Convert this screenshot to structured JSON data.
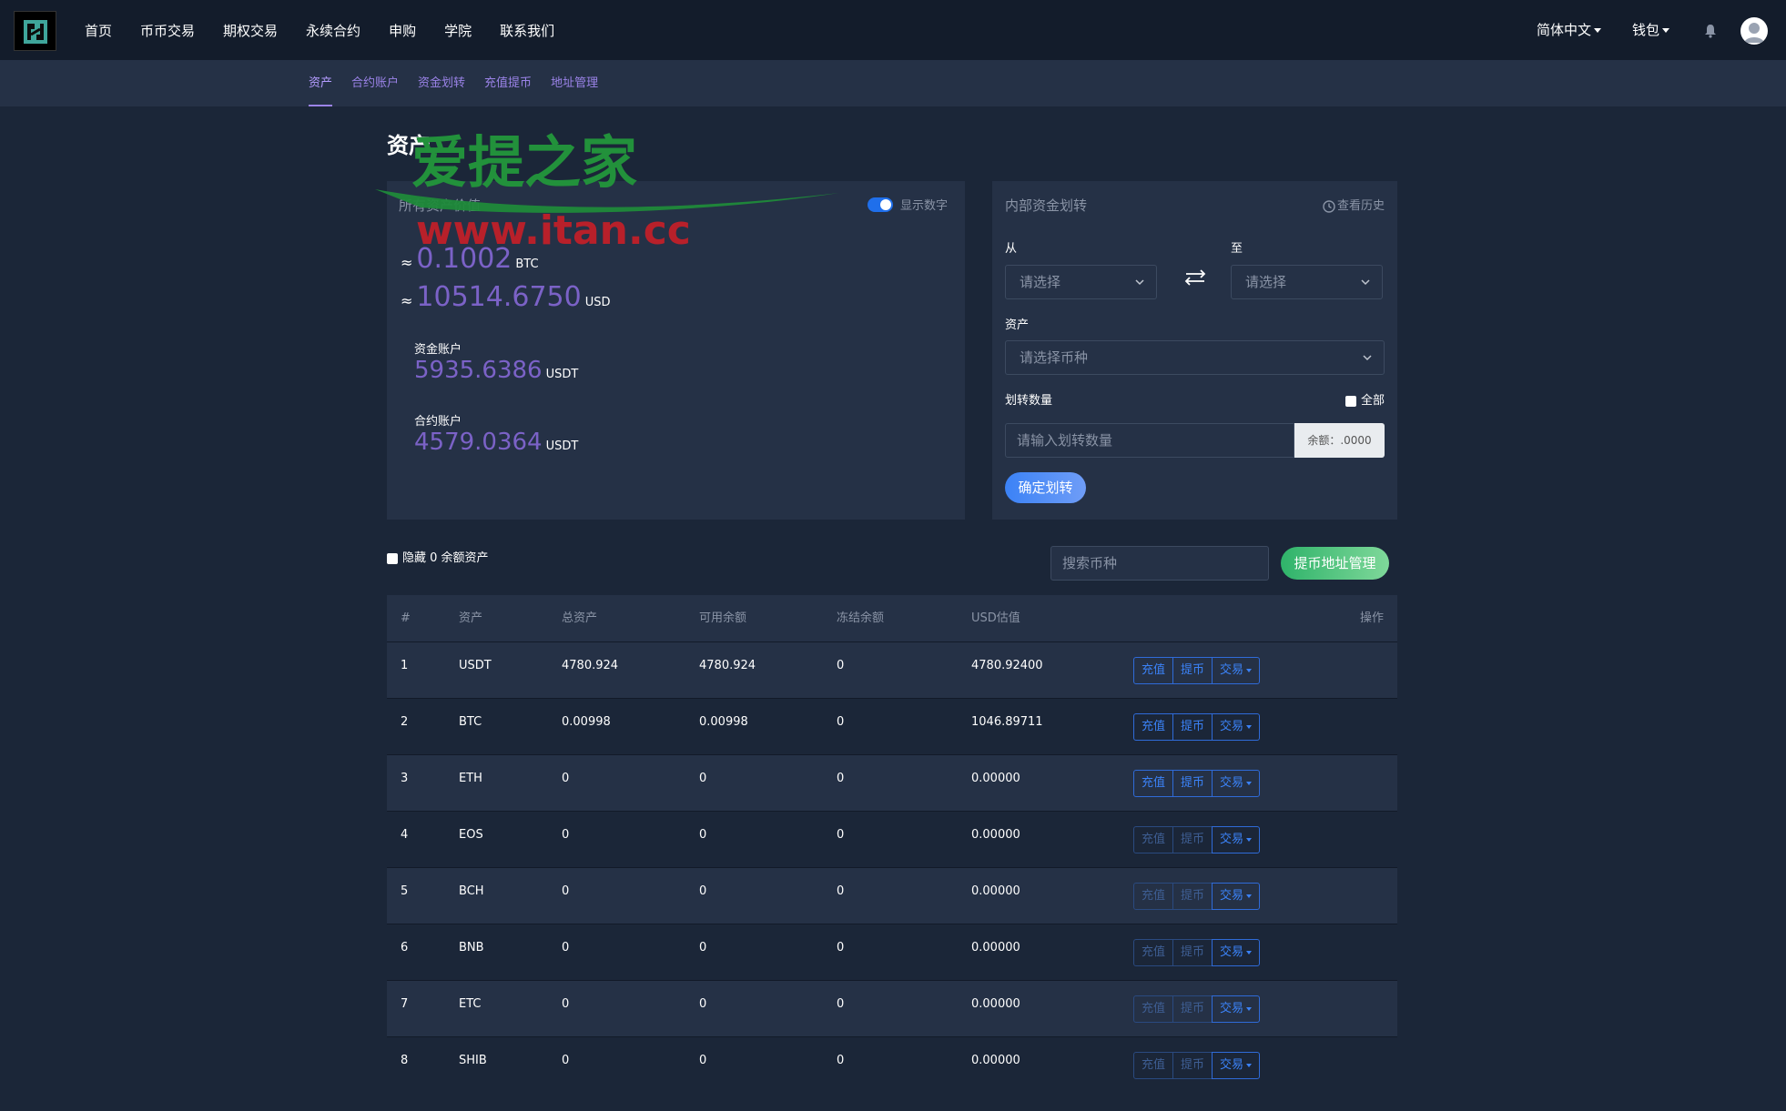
{
  "nav": {
    "items": [
      "首页",
      "币币交易",
      "期权交易",
      "永续合约",
      "申购",
      "学院",
      "联系我们"
    ],
    "language": "简体中文",
    "wallet": "钱包"
  },
  "subnav": {
    "items": [
      "资产",
      "合约账户",
      "资金划转",
      "充值提币",
      "地址管理"
    ]
  },
  "page": {
    "title": "资产"
  },
  "watermark": {
    "text": "爱提之家",
    "url": "www.itan.cc"
  },
  "assets_card": {
    "label": "所有资产价值",
    "toggle_label": "显示数字",
    "toggle_on": true,
    "approx": "≈",
    "btc_value": "0.1002",
    "btc_unit": "BTC",
    "usd_value": "10514.6750",
    "usd_unit": "USD",
    "fund_account_label": "资金账户",
    "fund_account_value": "5935.6386",
    "fund_account_unit": "USDT",
    "contract_account_label": "合约账户",
    "contract_account_value": "4579.0364",
    "contract_account_unit": "USDT"
  },
  "transfer": {
    "title": "内部资金划转",
    "history": "查看历史",
    "from_label": "从",
    "to_label": "至",
    "from_placeholder": "请选择",
    "to_placeholder": "请选择",
    "asset_label": "资产",
    "asset_placeholder": "请选择币种",
    "amount_label": "划转数量",
    "all_label": "全部",
    "amount_placeholder": "请输入划转数量",
    "balance": "余额：.0000",
    "confirm": "确定划转"
  },
  "list_controls": {
    "hide_zero": "隐藏 0 余额资产",
    "search_placeholder": "搜索币种",
    "address_button": "提币地址管理"
  },
  "table": {
    "headers": [
      "#",
      "资产",
      "总资产",
      "可用余额",
      "冻结余额",
      "USD估值",
      "操作"
    ],
    "actions": {
      "deposit": "充值",
      "withdraw": "提币",
      "trade": "交易"
    },
    "rows": [
      {
        "idx": "1",
        "symbol": "USDT",
        "total": "4780.924",
        "available": "4780.924",
        "frozen": "0",
        "usd": "4780.92400",
        "enabled": true
      },
      {
        "idx": "2",
        "symbol": "BTC",
        "total": "0.00998",
        "available": "0.00998",
        "frozen": "0",
        "usd": "1046.89711",
        "enabled": true
      },
      {
        "idx": "3",
        "symbol": "ETH",
        "total": "0",
        "available": "0",
        "frozen": "0",
        "usd": "0.00000",
        "enabled": true
      },
      {
        "idx": "4",
        "symbol": "EOS",
        "total": "0",
        "available": "0",
        "frozen": "0",
        "usd": "0.00000",
        "enabled": false
      },
      {
        "idx": "5",
        "symbol": "BCH",
        "total": "0",
        "available": "0",
        "frozen": "0",
        "usd": "0.00000",
        "enabled": false
      },
      {
        "idx": "6",
        "symbol": "BNB",
        "total": "0",
        "available": "0",
        "frozen": "0",
        "usd": "0.00000",
        "enabled": false
      },
      {
        "idx": "7",
        "symbol": "ETC",
        "total": "0",
        "available": "0",
        "frozen": "0",
        "usd": "0.00000",
        "enabled": false
      },
      {
        "idx": "8",
        "symbol": "SHIB",
        "total": "0",
        "available": "0",
        "frozen": "0",
        "usd": "0.00000",
        "enabled": false
      }
    ]
  },
  "colors": {
    "accent": "#7b62c7",
    "link": "#3b82f6",
    "green": "#2fb36a",
    "bg": "#1b2638",
    "card": "#253146"
  }
}
